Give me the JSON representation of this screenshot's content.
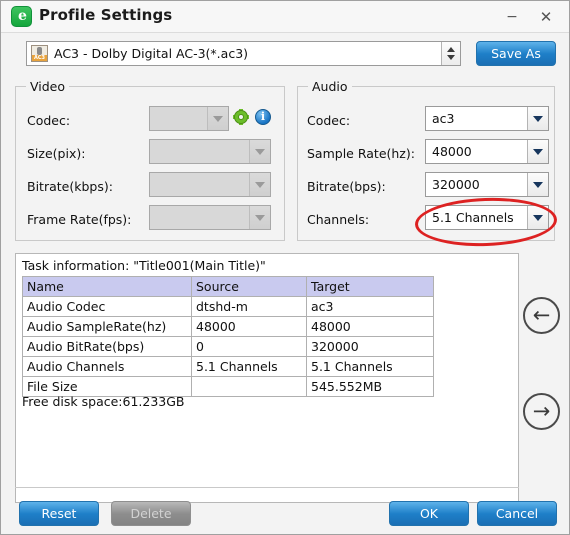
{
  "window": {
    "title": "Profile Settings",
    "app_icon": "profile-app-icon",
    "minimize_label": "−",
    "close_label": "✕"
  },
  "profile": {
    "selected": "AC3 - Dolby Digital AC-3(*.ac3)",
    "icon_tag": "AC3",
    "save_as_label": "Save As"
  },
  "video": {
    "legend": "Video",
    "fields": [
      {
        "label": "Codec:",
        "value": "",
        "disabled": true
      },
      {
        "label": "Size(pix):",
        "value": "",
        "disabled": true
      },
      {
        "label": "Bitrate(kbps):",
        "value": "",
        "disabled": true
      },
      {
        "label": "Frame Rate(fps):",
        "value": "",
        "disabled": true
      }
    ],
    "info_glyph": "i"
  },
  "audio": {
    "legend": "Audio",
    "fields": [
      {
        "label": "Codec:",
        "value": "ac3"
      },
      {
        "label": "Sample Rate(hz):",
        "value": "48000"
      },
      {
        "label": "Bitrate(bps):",
        "value": "320000"
      },
      {
        "label": "Channels:",
        "value": "5.1 Channels"
      }
    ]
  },
  "annotation": {
    "shape": "ellipse",
    "color": "#dd2222",
    "targets": "audio-channels-combo"
  },
  "task": {
    "title": "Task information: \"Title001(Main Title)\"",
    "columns": [
      "Name",
      "Source",
      "Target"
    ],
    "rows": [
      [
        "Audio Codec",
        "dtshd-m",
        "ac3"
      ],
      [
        "Audio SampleRate(hz)",
        "48000",
        "48000"
      ],
      [
        "Audio BitRate(bps)",
        "0",
        "320000"
      ],
      [
        "Audio Channels",
        "5.1 Channels",
        "5.1 Channels"
      ],
      [
        "File Size",
        "",
        "545.552MB"
      ]
    ],
    "free_space": "Free disk space:61.233GB"
  },
  "nav": {
    "prev_label": "←",
    "next_label": "→"
  },
  "footer": {
    "reset_label": "Reset",
    "delete_label": "Delete",
    "ok_label": "OK",
    "cancel_label": "Cancel"
  }
}
